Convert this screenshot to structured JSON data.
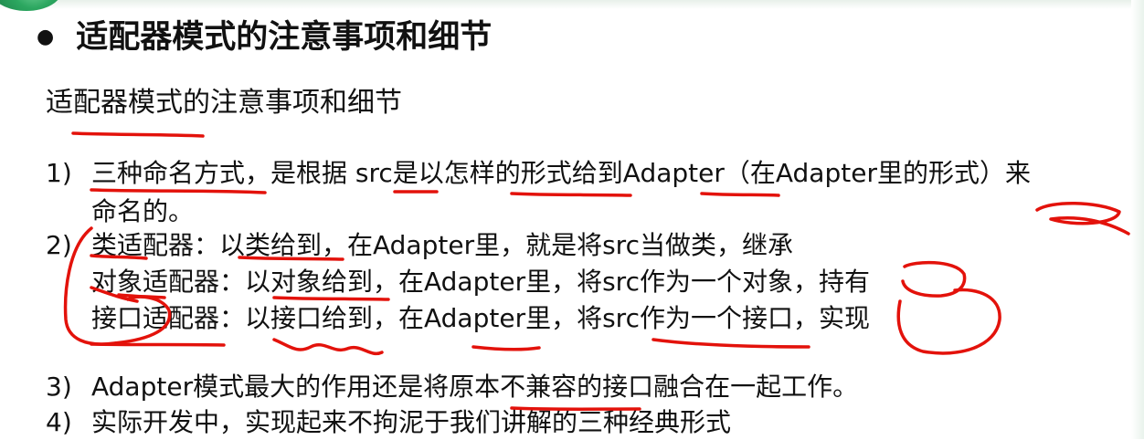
{
  "slide": {
    "bullet": "●",
    "title": "适配器模式的注意事项和细节",
    "subheading": "适配器模式的注意事项和细节",
    "points": [
      {
        "num": "1)",
        "lines": [
          "三种命名方式，是根据 src是以怎样的形式给到Adapter（在Adapter里的形式）来",
          "命名的。"
        ]
      },
      {
        "num": "2)",
        "lines": [
          "类适配器：以类给到，在Adapter里，就是将src当做类，继承",
          "对象适配器：以对象给到，在Adapter里，将src作为一个对象，持有",
          "接口适配器：以接口给到，在Adapter里，将src作为一个接口，实现"
        ]
      },
      {
        "num": "3)",
        "lines": [
          "Adapter模式最大的作用还是将原本不兼容的接口融合在一起工作。"
        ]
      },
      {
        "num": "4)",
        "lines": [
          "实际开发中，实现起来不拘泥于我们讲解的三种经典形式"
        ]
      }
    ]
  },
  "colors": {
    "annotation": "#e3120b",
    "text": "#111111",
    "decor": "#2ca760"
  }
}
